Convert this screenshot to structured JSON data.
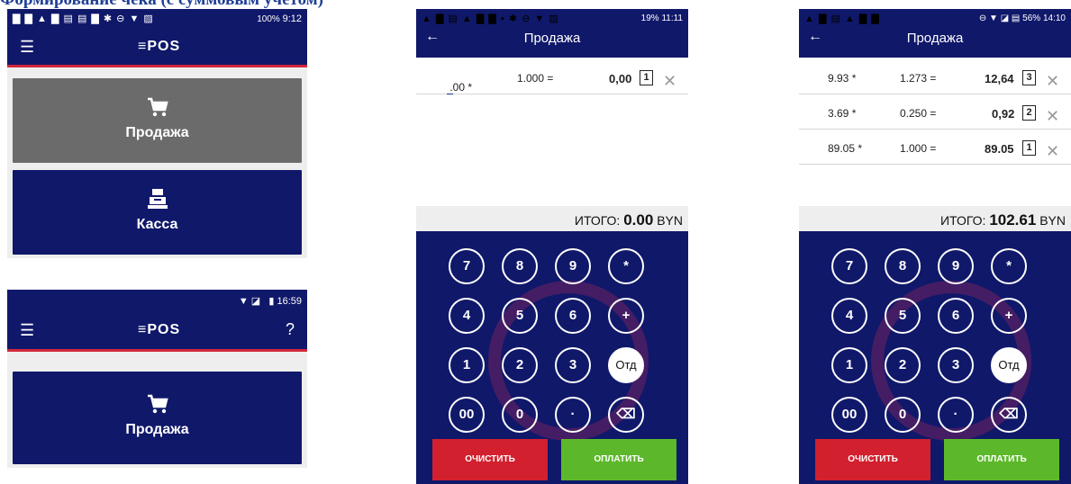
{
  "doc_title": "Формирование чека (с суммовым учетом)",
  "screen1": {
    "status_icons": "▇ ▇ ▲ ▇ ▤ ▤ ▇   ✱ ⊖ ▼ ▨",
    "battery": "100%",
    "time": "9:12",
    "logo": "≡POS",
    "tiles": [
      {
        "label": "Продажа"
      },
      {
        "label": "Касса"
      }
    ]
  },
  "screen2": {
    "time": "16:59",
    "logo": "≡POS",
    "help": "?",
    "tile_label": "Продажа"
  },
  "screen3": {
    "status_icons": "▲ ▇ ▤ ▲ ▇ ▇ ▪   ✱ ⊖ ▼ ▨",
    "battery": "19%",
    "time": "11:11",
    "title": "Продажа",
    "rows": [
      {
        "price": ".00 *",
        "qty": "1.000 =",
        "sum": "0,00",
        "index": "1"
      }
    ],
    "total_label": "ИТОГО:",
    "total_value": "0.00",
    "currency": "BYN"
  },
  "screen4": {
    "status_icons": "▲ ▇ ▤ ▲ ▇ ▇",
    "battery": "56%",
    "time": "14:10",
    "title": "Продажа",
    "rows": [
      {
        "price": "9.93 *",
        "qty": "1.273 =",
        "sum": "12,64",
        "index": "3"
      },
      {
        "price": "3.69 *",
        "qty": "0.250 =",
        "sum": "0,92",
        "index": "2"
      },
      {
        "price": "89.05 *",
        "qty": "1.000 =",
        "sum": "89.05",
        "index": "1"
      }
    ],
    "total_label": "ИТОГО:",
    "total_value": "102.61",
    "currency": "BYN"
  },
  "keypad": {
    "keys": [
      "7",
      "8",
      "9",
      "*",
      "4",
      "5",
      "6",
      "+",
      "1",
      "2",
      "3",
      "Отд",
      "00",
      "0",
      "·",
      "⌫"
    ],
    "clear_label": "ОЧИСТИТЬ",
    "pay_label": "ОПЛАТИТЬ"
  },
  "icons": {
    "cart": "cart-icon",
    "register": "cash-register-icon",
    "back": "back-arrow-icon",
    "delete": "close-icon",
    "menu": "menu-icon"
  },
  "colors": {
    "navy": "#10186a",
    "gray_tile": "#6b6b6b",
    "accent_red": "#d2283c",
    "clear_red": "#d2202f",
    "pay_green": "#5cb82a"
  }
}
